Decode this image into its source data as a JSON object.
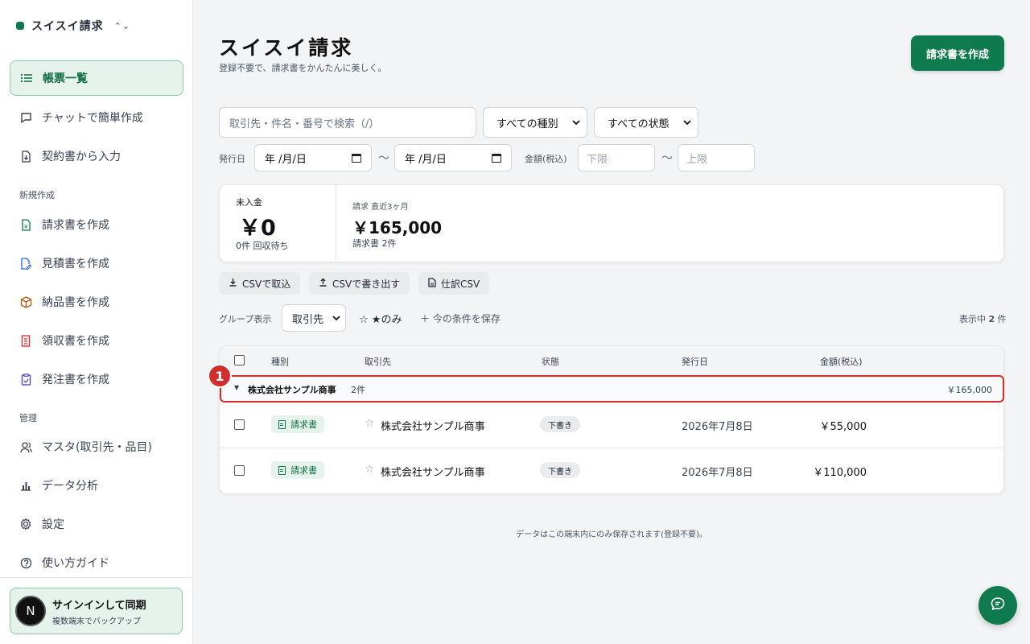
{
  "brand": {
    "name": "スイスイ請求"
  },
  "sidebar": {
    "main_items": [
      {
        "label": "帳票一覧",
        "icon": "list-icon",
        "active": true
      },
      {
        "label": "チャットで簡単作成",
        "icon": "chat-icon"
      },
      {
        "label": "契約書から入力",
        "icon": "import-doc-icon"
      }
    ],
    "section_new": "新規作成",
    "new_items": [
      {
        "label": "請求書を作成",
        "icon": "invoice-icon"
      },
      {
        "label": "見積書を作成",
        "icon": "quote-icon"
      },
      {
        "label": "納品書を作成",
        "icon": "box-icon"
      },
      {
        "label": "領収書を作成",
        "icon": "receipt-icon"
      },
      {
        "label": "発注書を作成",
        "icon": "order-icon"
      }
    ],
    "section_manage": "管理",
    "manage_items": [
      {
        "label": "マスタ(取引先・品目)",
        "icon": "user-icon"
      },
      {
        "label": "データ分析",
        "icon": "bar-chart-icon"
      },
      {
        "label": "設定",
        "icon": "gear-icon"
      },
      {
        "label": "使い方ガイド",
        "icon": "help-icon"
      }
    ],
    "signin": {
      "avatar": "N",
      "title": "サインインして同期",
      "subtitle": "複数端末でバックアップ"
    }
  },
  "header": {
    "title": "スイスイ請求",
    "subtitle": "登録不要で、請求書をかんたんに美しく。",
    "create_button": "請求書を作成"
  },
  "filters": {
    "search_placeholder": "取引先・件名・番号で検索（/）",
    "type_select": "すべての種別",
    "status_select": "すべての状態",
    "date_label": "発行日",
    "date_from": "年 /月/日",
    "date_to": "年 /月/日",
    "tilde": "〜",
    "amount_label": "金額(税込)",
    "amount_min_placeholder": "下限",
    "amount_max_placeholder": "上限"
  },
  "summary": {
    "unpaid_label": "未入金",
    "unpaid_amount": "￥0",
    "unpaid_sub": "0件 回収待ち",
    "recent_label": "請求 直近3ヶ月",
    "recent_amount": "￥165,000",
    "recent_sub": "請求書 2件"
  },
  "actions": {
    "import_csv": "CSVで取込",
    "export_csv": "CSVで書き出す",
    "journal_csv": "仕訳CSV"
  },
  "group": {
    "label": "グループ表示",
    "select": "取引先",
    "star_only": "☆ ★のみ",
    "save_condition": "＋ 今の条件を保存",
    "count_prefix": "表示中",
    "count": "2",
    "count_suffix": "件"
  },
  "table": {
    "headers": {
      "type": "種別",
      "client": "取引先",
      "status": "状態",
      "date": "発行日",
      "amount": "金額(税込)"
    },
    "group_row": {
      "name": "株式会社サンプル商事",
      "count": "2件",
      "total": "￥165,000"
    },
    "rows": [
      {
        "type": "請求書",
        "client": "株式会社サンプル商事",
        "status": "下書き",
        "date": "2026年7月8日",
        "amount": "￥55,000"
      },
      {
        "type": "請求書",
        "client": "株式会社サンプル商事",
        "status": "下書き",
        "date": "2026年7月8日",
        "amount": "￥110,000"
      }
    ]
  },
  "annotation": {
    "marker": "1"
  },
  "footer": {
    "note": "データはこの端末内にのみ保存されます(登録不要)。"
  },
  "colors": {
    "brand": "#0f7a4e",
    "highlight": "#d12f2f",
    "active_bg": "#e6f3ec"
  }
}
